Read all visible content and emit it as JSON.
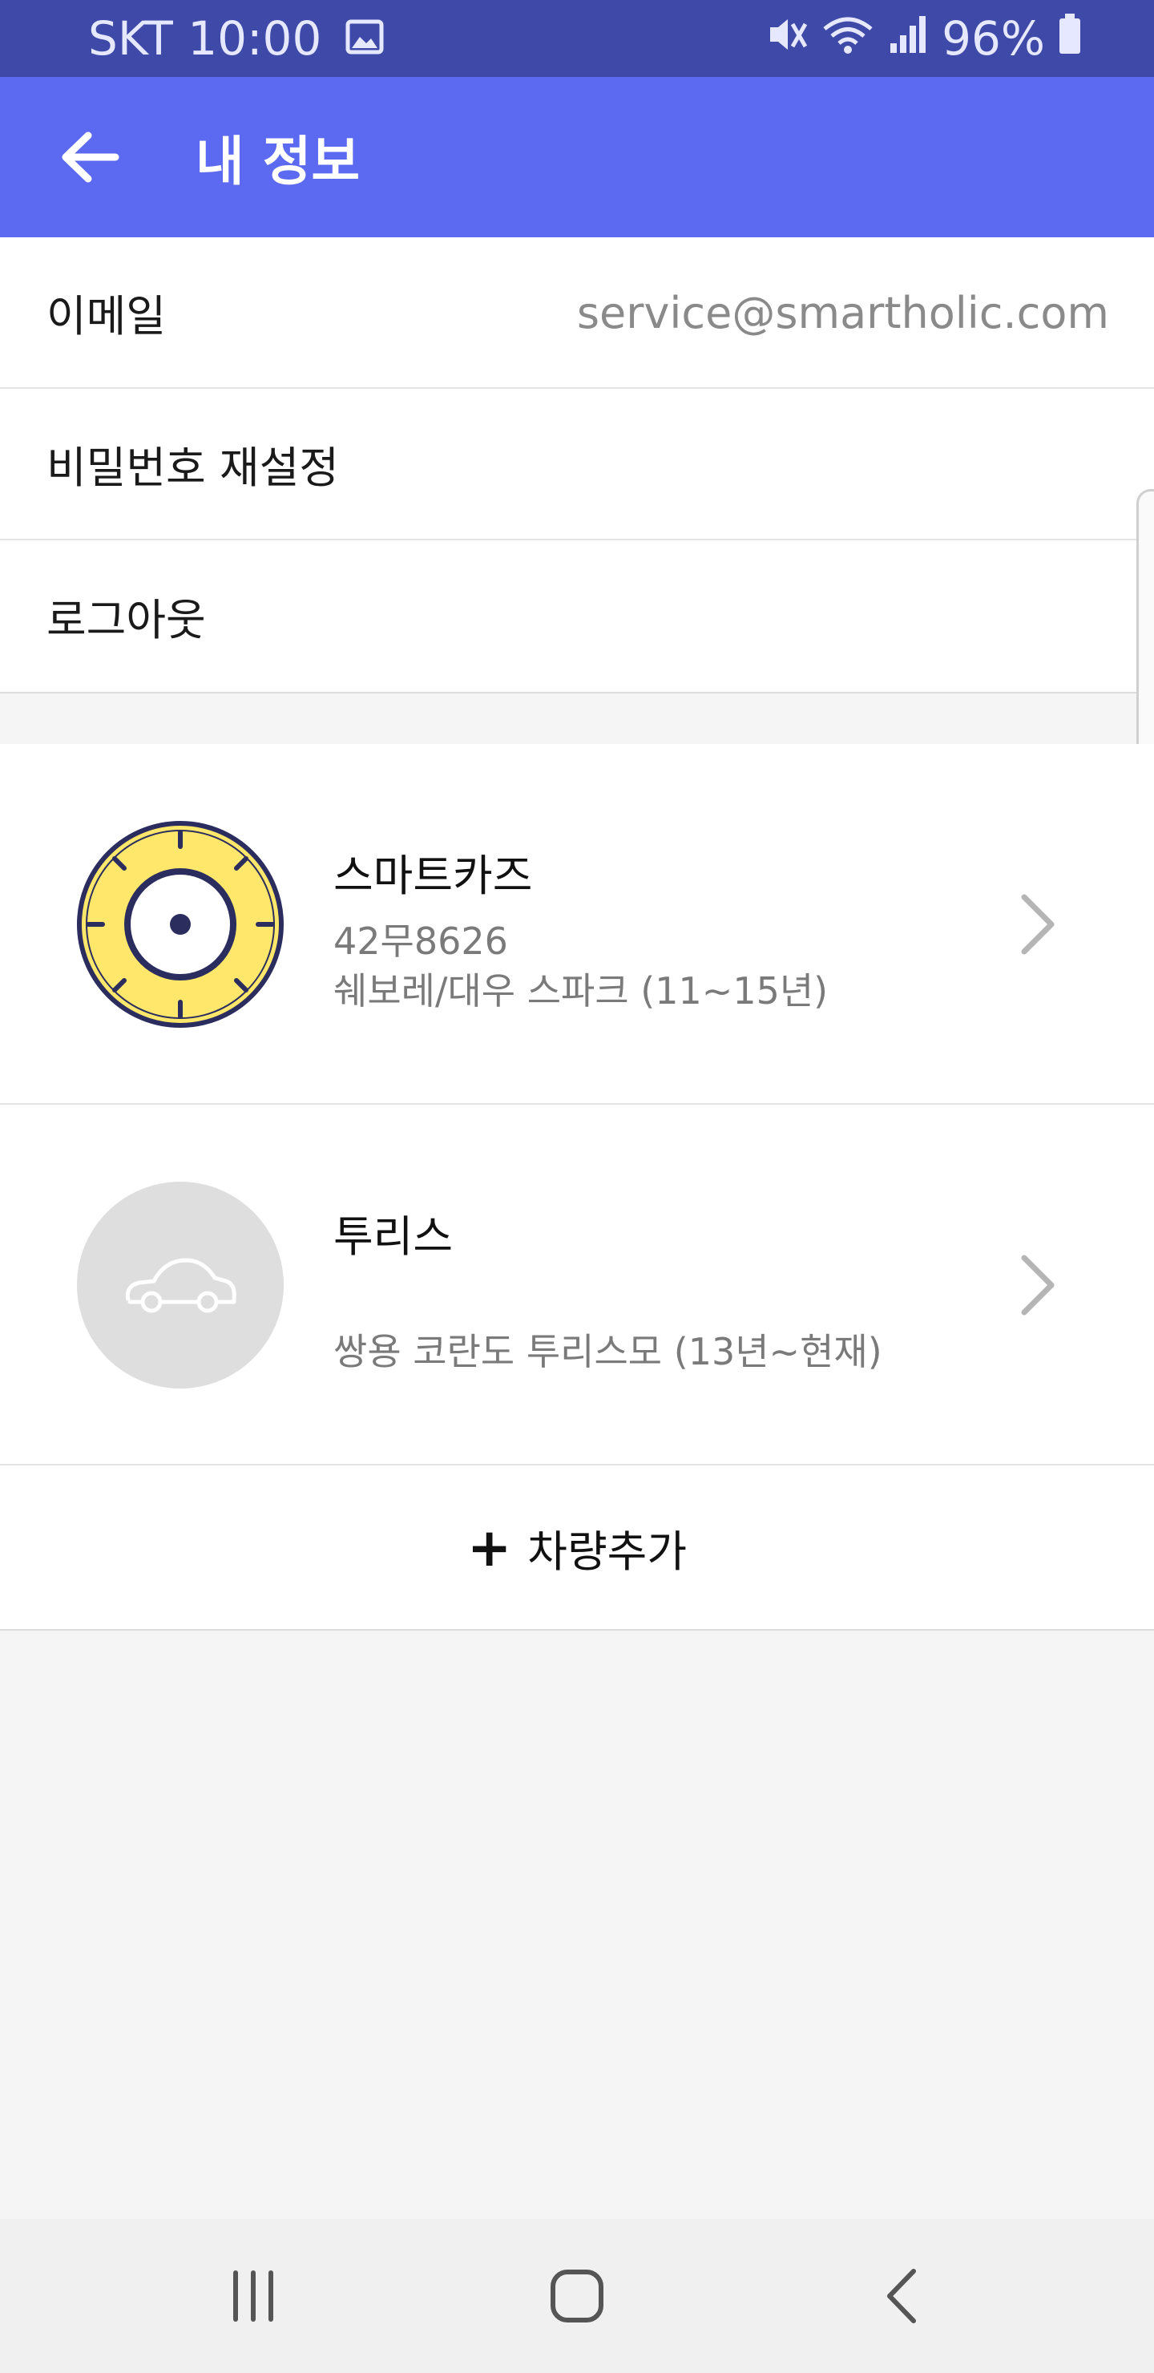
{
  "status_bar": {
    "carrier_time": "SKT 10:00",
    "battery": "96%",
    "icons": [
      "gallery-icon",
      "mute-vibrate-icon",
      "wifi-icon",
      "signal-icon",
      "battery-icon"
    ]
  },
  "app_bar": {
    "title": "내 정보",
    "back_icon": "arrow-left-icon",
    "color": "#5b6af0"
  },
  "account": {
    "email_label": "이메일",
    "email_value": "service@smartholic.com",
    "reset_password_label": "비밀번호 재설정",
    "logout_label": "로그아웃"
  },
  "vehicles": [
    {
      "name": "스마트카즈",
      "plate": "42무8626",
      "model": "쉐보레/대우 스파크 (11~15년)",
      "icon": "gauge-icon"
    },
    {
      "name": "투리스",
      "plate": "",
      "model": "쌍용 코란도 투리스모 (13년~현재)",
      "icon": "car-icon"
    }
  ],
  "add_vehicle": {
    "plus": "+",
    "label": "차량추가"
  },
  "nav_bar": {
    "icons": [
      "recent-apps-icon",
      "home-icon",
      "back-icon"
    ]
  }
}
